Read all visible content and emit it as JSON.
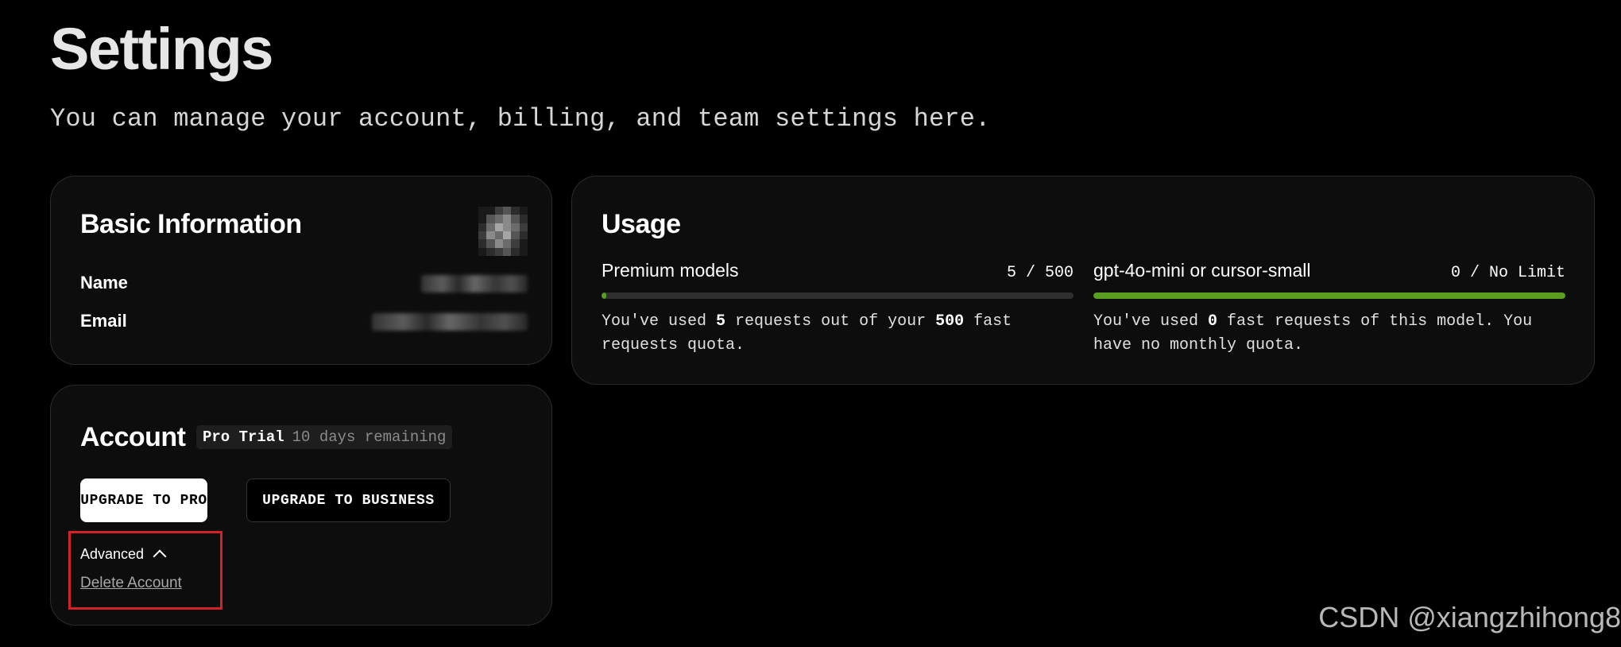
{
  "header": {
    "title": "Settings",
    "subtitle": "You can manage your account, billing, and team settings here."
  },
  "basic_info": {
    "heading": "Basic Information",
    "name_label": "Name",
    "email_label": "Email"
  },
  "account": {
    "heading": "Account",
    "plan": "Pro Trial",
    "remaining": "10 days remaining",
    "upgrade_pro_label": "UPGRADE TO PRO",
    "upgrade_business_label": "UPGRADE TO BUSINESS",
    "advanced_label": "Advanced",
    "delete_label": "Delete Account",
    "highlight_color": "#d3232a"
  },
  "usage": {
    "heading": "Usage",
    "premium": {
      "name": "Premium models",
      "count": "5 / 500",
      "used": 5,
      "limit": 500,
      "desc_prefix": "You've used ",
      "desc_used": "5",
      "desc_mid": " requests out of your ",
      "desc_limit": "500",
      "desc_suffix": " fast requests quota."
    },
    "mini": {
      "name": "gpt-4o-mini or cursor-small",
      "count": "0 / No Limit",
      "fill_fraction": 1,
      "desc_prefix": "You've used ",
      "desc_used": "0",
      "desc_suffix": " fast requests of this model. You have no monthly quota."
    },
    "bar_color": "#5a9e1f"
  },
  "watermark": "CSDN @xiangzhihong8",
  "icons": {
    "advanced_toggle": "chevron-up-icon"
  }
}
